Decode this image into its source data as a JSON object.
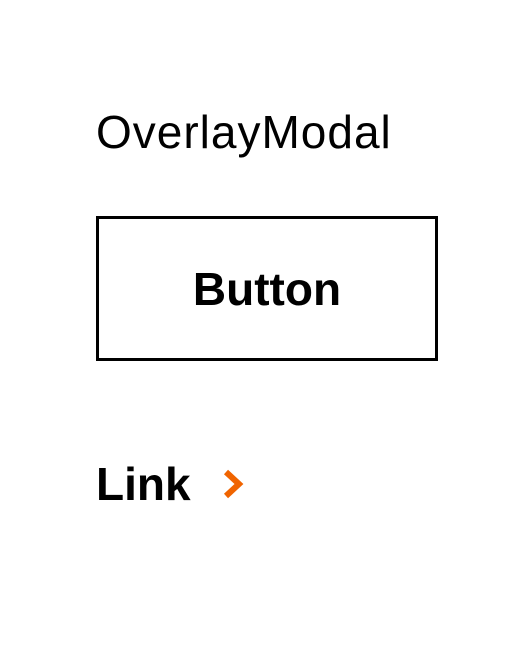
{
  "overlay": {
    "title": "OverlayModal"
  },
  "primary_button": {
    "label": "Button"
  },
  "link": {
    "label": "Link",
    "icon": "chevron-right-icon",
    "icon_color": "#f06400"
  }
}
